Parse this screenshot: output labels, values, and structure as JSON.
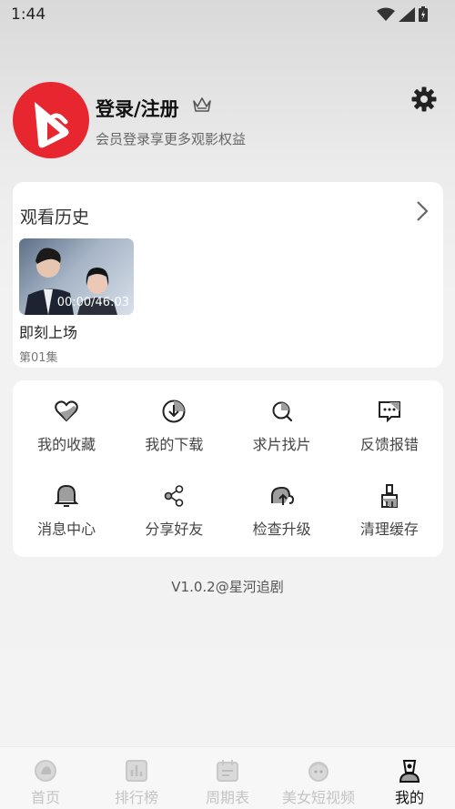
{
  "status_bar": {
    "time": "1:44"
  },
  "profile": {
    "login_title": "登录/注册",
    "subtitle": "会员登录享更多观影权益"
  },
  "history": {
    "title": "观看历史",
    "items": [
      {
        "time": "00:00/46:03",
        "title": "即刻上场",
        "episode": "第01集"
      }
    ]
  },
  "menu": {
    "items": [
      {
        "label": "我的收藏",
        "icon": "heart-icon"
      },
      {
        "label": "我的下载",
        "icon": "download-icon"
      },
      {
        "label": "求片找片",
        "icon": "search-icon"
      },
      {
        "label": "反馈报错",
        "icon": "feedback-icon"
      },
      {
        "label": "消息中心",
        "icon": "bell-icon"
      },
      {
        "label": "分享好友",
        "icon": "share-icon"
      },
      {
        "label": "检查升级",
        "icon": "upgrade-icon"
      },
      {
        "label": "清理缓存",
        "icon": "broom-icon"
      }
    ]
  },
  "version": "V1.0.2@星河追剧",
  "tabs": [
    {
      "label": "首页",
      "icon": "home-icon",
      "active": false
    },
    {
      "label": "排行榜",
      "icon": "ranking-icon",
      "active": false
    },
    {
      "label": "周期表",
      "icon": "calendar-icon",
      "active": false
    },
    {
      "label": "美女短视频",
      "icon": "short-video-icon",
      "active": false
    },
    {
      "label": "我的",
      "icon": "profile-icon",
      "active": true
    }
  ],
  "colors": {
    "brand": "#e8262f",
    "active_tab": "#111111",
    "inactive_tab": "#c4c4c4"
  }
}
